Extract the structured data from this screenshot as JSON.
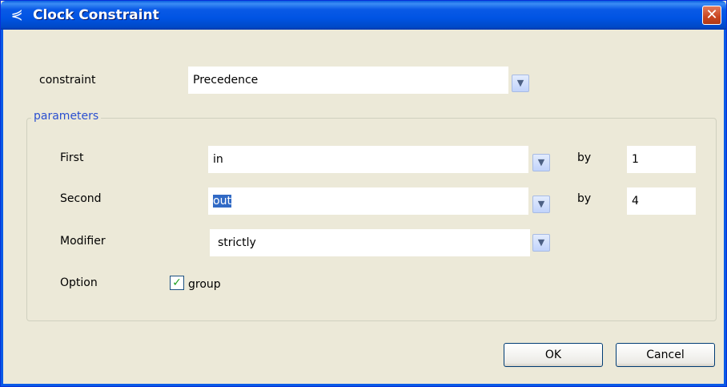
{
  "window": {
    "title": "Clock Constraint",
    "app_icon": "clock-constraint-icon",
    "close_glyph": "✕"
  },
  "constraint": {
    "label": "constraint",
    "value": "Precedence"
  },
  "parameters": {
    "legend": "parameters",
    "first": {
      "label": "First",
      "value": "in",
      "by_label": "by",
      "by_value": "1"
    },
    "second": {
      "label": "Second",
      "value": "out",
      "by_label": "by",
      "by_value": "4"
    },
    "modifier": {
      "label": "Modifier",
      "value": "strictly"
    },
    "option": {
      "label": "Option",
      "checkbox_label": "group",
      "checked": true
    }
  },
  "buttons": {
    "ok": "OK",
    "cancel": "Cancel"
  },
  "colors": {
    "title_bar": "#0054e3",
    "accent": "#316ac5",
    "window_bg": "#ece9d8"
  }
}
